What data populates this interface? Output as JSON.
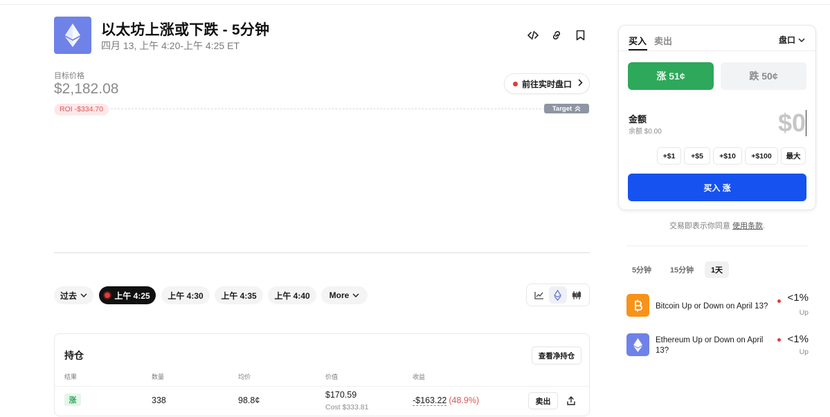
{
  "header": {
    "title": "以太坊上涨或下跌 - 5分钟",
    "subtitle": "四月 13, 上午 4:20-上午 4:25 ET"
  },
  "icons": {
    "logo": "ethereum-logo-icon",
    "embed": "code-embed-icon",
    "link": "link-icon",
    "bookmark": "bookmark-icon"
  },
  "target": {
    "label": "目标价格",
    "value": "$2,182.08",
    "roi": "ROI -$334.70",
    "badge": "Target"
  },
  "live_button": {
    "label": "前往实时盘口"
  },
  "time_filters": {
    "past": "过去",
    "items": [
      "上午 4:25",
      "上午 4:30",
      "上午 4:35",
      "上午 4:40"
    ],
    "active_index": 0,
    "more": "More"
  },
  "positions": {
    "title": "持仓",
    "net_button": "查看净持仓",
    "columns": [
      "结果",
      "数量",
      "均价",
      "价值",
      "收益"
    ],
    "rows": [
      {
        "outcome": "涨",
        "shares": "338",
        "avg": "98.8¢",
        "value": "$170.59",
        "cost": "Cost $333.81",
        "pnl": "-$163.22",
        "pnl_pct": "(48.9%)",
        "sell": "卖出"
      }
    ]
  },
  "trade": {
    "tabs": [
      "买入",
      "卖出"
    ],
    "order_type": "盘口",
    "up_label": "涨 51¢",
    "down_label": "跌 50¢",
    "amount_label": "金额",
    "balance": "余额 $0.00",
    "amount_value": "$0",
    "quick_amounts": [
      "+$1",
      "+$5",
      "+$10",
      "+$100",
      "最大"
    ],
    "buy_label": "买入 涨"
  },
  "terms": {
    "text": "交易即表示你同意",
    "link": "使用条款",
    "end": "."
  },
  "market_tabs": {
    "items": [
      "5分钟",
      "15分钟",
      "1天"
    ],
    "active_index": 2
  },
  "related": [
    {
      "name": "Bitcoin Up or Down on April 13?",
      "pct": "<1%",
      "sub": "Up",
      "icon": "bitcoin-icon",
      "color": "#f7931a"
    },
    {
      "name": "Ethereum Up or Down on April 13?",
      "pct": "<1%",
      "sub": "Up",
      "icon": "ethereum-icon",
      "color": "#6f82e8"
    }
  ],
  "colors": {
    "up_green": "#2ea85a",
    "buy_blue": "#1652f0",
    "loss_red": "#e05555",
    "eth_brand": "#6f82e8"
  }
}
